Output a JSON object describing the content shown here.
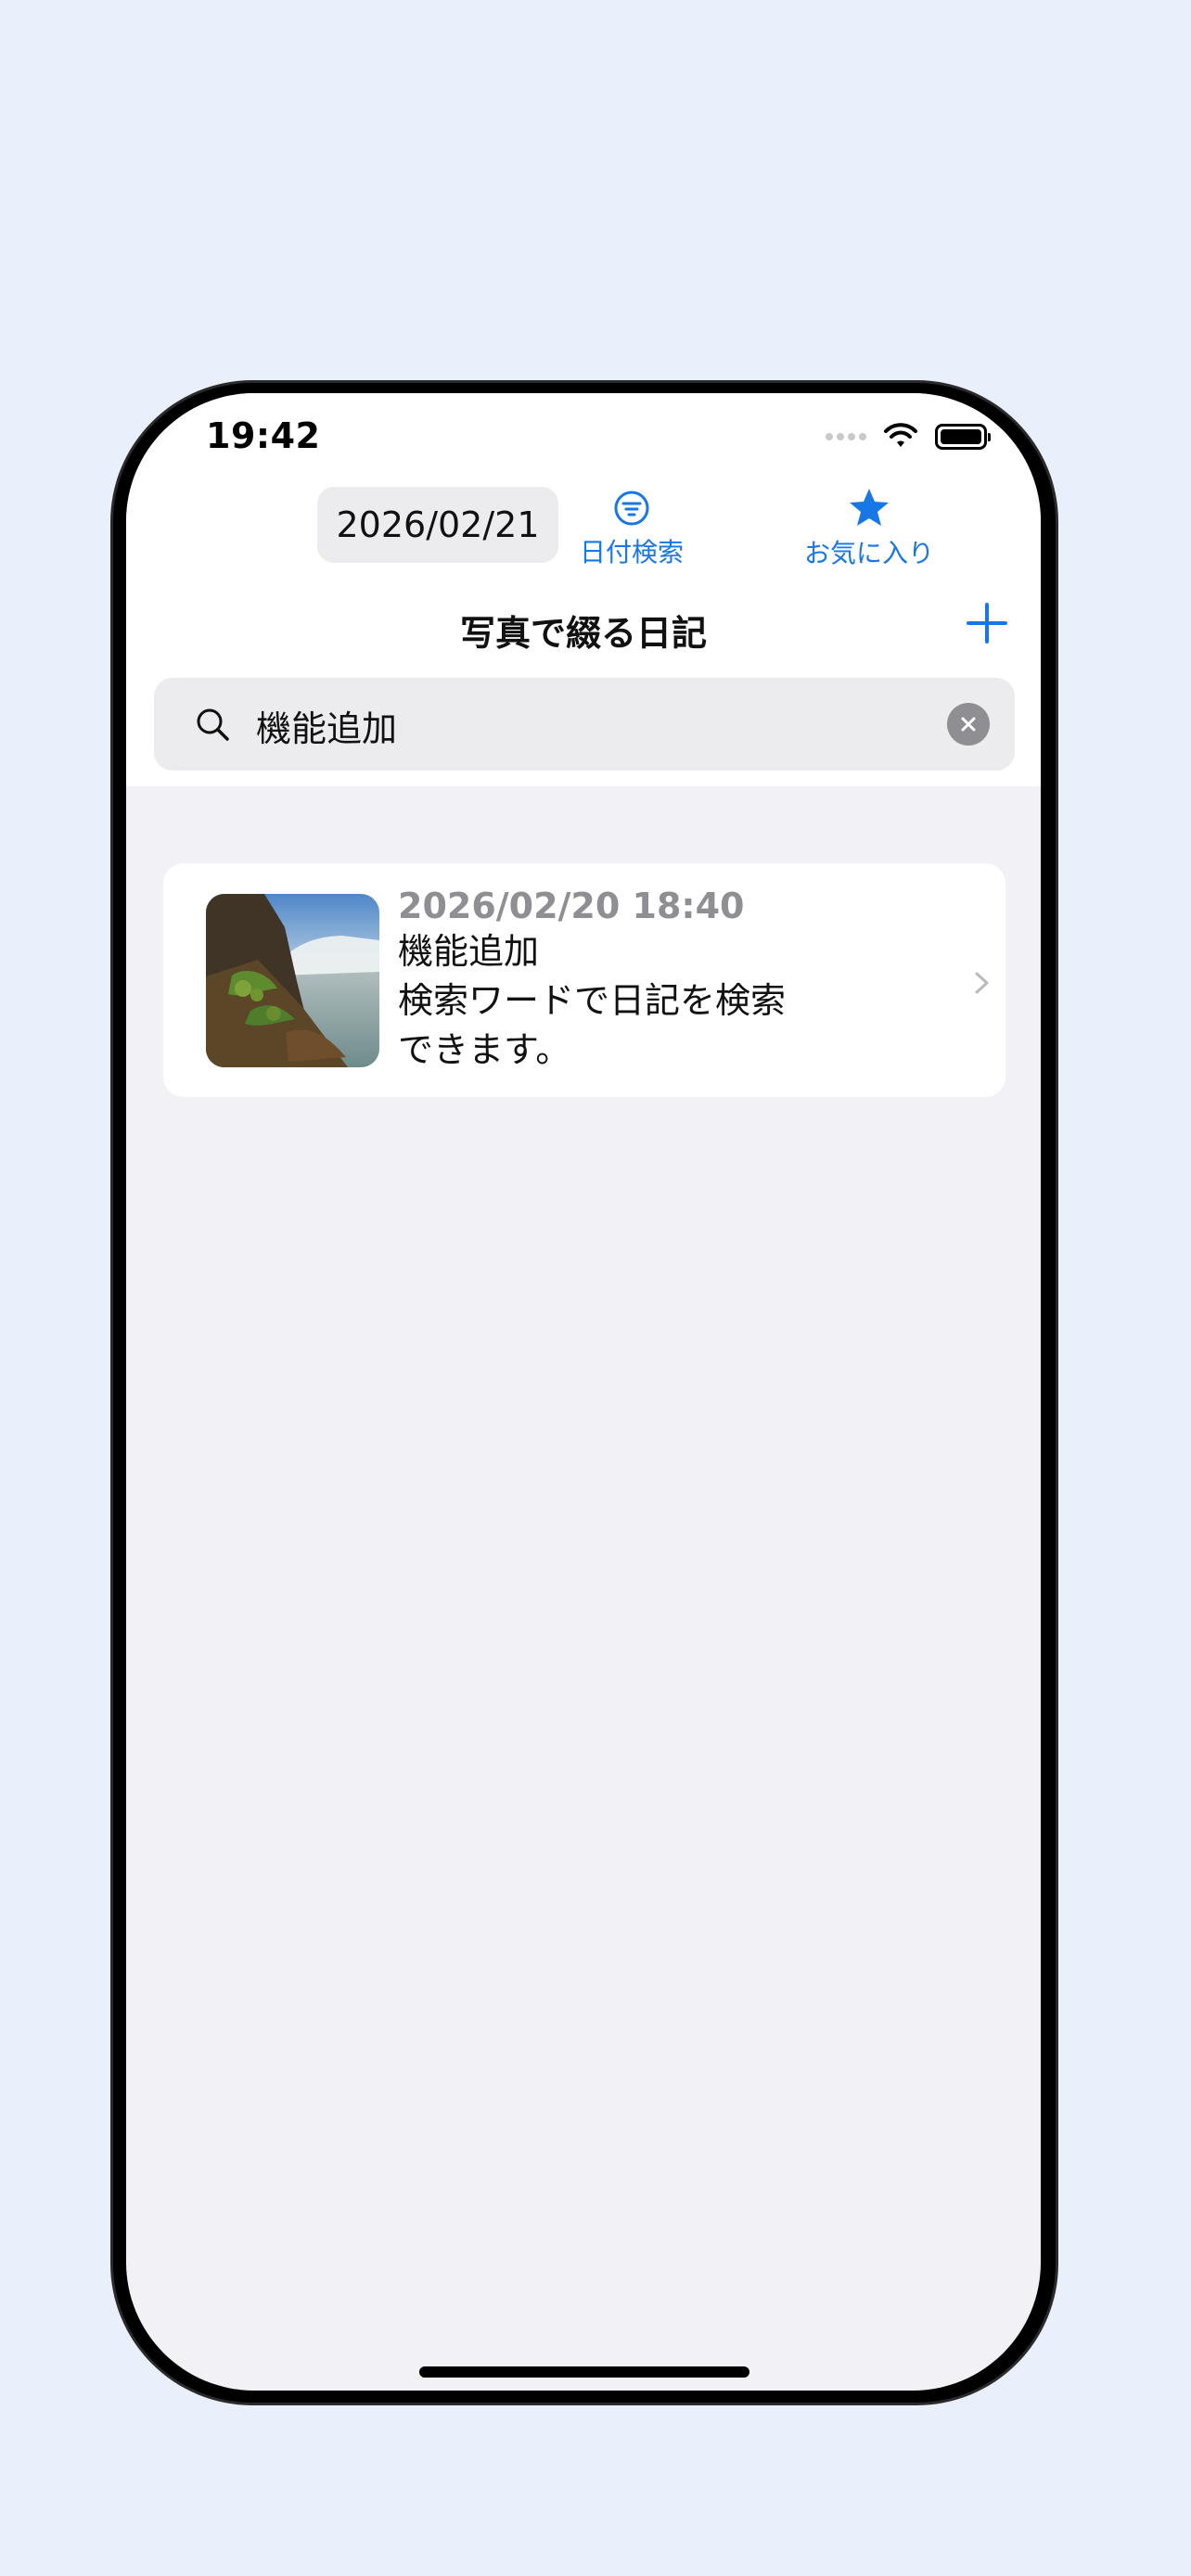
{
  "status_bar": {
    "time": "19:42",
    "wifi_icon": "wifi-icon",
    "battery_icon": "battery-icon"
  },
  "top_bar": {
    "date_picker": "2026/02/21",
    "date_search_label": "日付検索",
    "favorites_label": "お気に入り",
    "date_search_icon": "filter-icon",
    "favorites_icon": "star-icon"
  },
  "navigation": {
    "title": "写真で綴る日記",
    "add_icon": "plus-icon"
  },
  "search": {
    "value": "機能追加",
    "search_icon": "search-icon",
    "clear_icon": "clear-icon"
  },
  "entries": [
    {
      "datetime": "2026/02/20 18:40",
      "title": "機能追加",
      "line2": "検索ワードで日記を検索",
      "line3": "できます。",
      "thumbnail_icon": "waterfall-photo"
    }
  ],
  "colors": {
    "background": "#e9f0fc",
    "screen_background": "#f1f1f6",
    "accent": "#1877e6",
    "secondary_text": "#8e8e93"
  }
}
